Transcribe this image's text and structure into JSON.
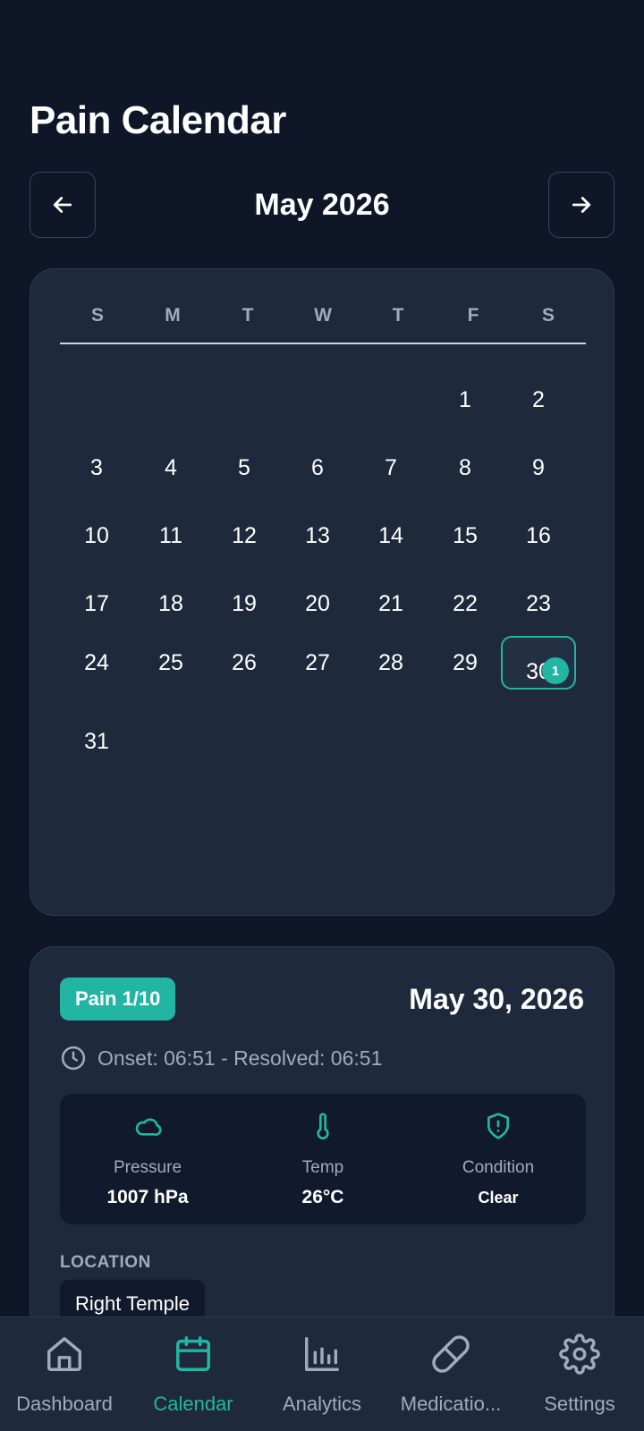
{
  "header": {
    "title": "Pain Calendar"
  },
  "month_nav": {
    "month_label": "May 2026"
  },
  "calendar": {
    "weekdays": [
      "S",
      "M",
      "T",
      "W",
      "T",
      "F",
      "S"
    ],
    "days": [
      "1",
      "2",
      "3",
      "4",
      "5",
      "6",
      "7",
      "8",
      "9",
      "10",
      "11",
      "12",
      "13",
      "14",
      "15",
      "16",
      "17",
      "18",
      "19",
      "20",
      "21",
      "22",
      "23",
      "24",
      "25",
      "26",
      "27",
      "28",
      "29",
      "30",
      "31"
    ],
    "selected_day": "30",
    "selected_badge": "1"
  },
  "entry": {
    "pain_badge": "Pain 1/10",
    "date": "May 30, 2026",
    "time_range": "Onset: 06:51 - Resolved: 06:51",
    "weather": {
      "pressure_label": "Pressure",
      "pressure_value": "1007 hPa",
      "temp_label": "Temp",
      "temp_value": "26°C",
      "condition_label": "Condition",
      "condition_value": "Clear"
    },
    "location_label": "LOCATION",
    "location_value": "Right Temple"
  },
  "bottom_nav": {
    "items": [
      {
        "label": "Dashboard"
      },
      {
        "label": "Calendar"
      },
      {
        "label": "Analytics"
      },
      {
        "label": "Medicatio..."
      },
      {
        "label": "Settings"
      }
    ],
    "active_index": 1
  },
  "colors": {
    "accent": "#22b5a4",
    "background": "#0e1628",
    "card": "#1e293c"
  },
  "icons": {
    "prev": "arrow-left-icon",
    "next": "arrow-right-icon",
    "time": "clock-icon",
    "pressure": "cloud-icon",
    "temp": "thermometer-icon",
    "condition": "shield-alert-icon"
  }
}
